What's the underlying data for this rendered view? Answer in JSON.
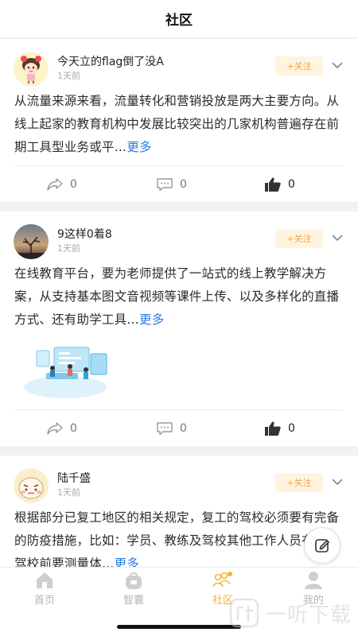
{
  "header": {
    "title": "社区"
  },
  "posts": [
    {
      "author": "今天立的flag倒了没A",
      "time": "1天前",
      "follow_label": "+关注",
      "text": "从流量来源来看，流量转化和营销投放是两大主要方向。从线上起家的教育机构中发展比较突出的几家机构普遍存在前期工具型业务或平…",
      "more_label": "更多",
      "shares": "0",
      "comments": "0",
      "likes": "0",
      "avatar_icon": "cartoon-girl-avatar"
    },
    {
      "author": "9这样0着8",
      "time": "1天前",
      "follow_label": "+关注",
      "text": "在线教育平台，要为老师提供了一站式的线上教学解决方案，从支持基本图文音视频等课件上传、以及多样化的直播方式、还有助学工具…",
      "more_label": "更多",
      "shares": "0",
      "comments": "0",
      "likes": "0",
      "avatar_icon": "sunset-tree-avatar"
    },
    {
      "author": "陆千盛",
      "time": "1天前",
      "follow_label": "+关注",
      "text": "根据部分已复工地区的相关规定，复工的驾校必须要有完备的防疫措施，比如：学员、教练及驾校其他工作人员在进入驾校前要测量体…",
      "more_label": "更多",
      "avatar_icon": "cartoon-face-avatar"
    }
  ],
  "tabs": [
    {
      "label": "首页",
      "icon": "home-icon"
    },
    {
      "label": "智囊",
      "icon": "bag-icon"
    },
    {
      "label": "社区",
      "icon": "community-icon",
      "active": true
    },
    {
      "label": "我的",
      "icon": "user-icon"
    }
  ],
  "watermark": {
    "text": "一听下载"
  },
  "colors": {
    "accent": "#f0b43a",
    "link": "#2c7be5",
    "follow_bg": "#fff4e0",
    "follow_text": "#f0a64a"
  }
}
